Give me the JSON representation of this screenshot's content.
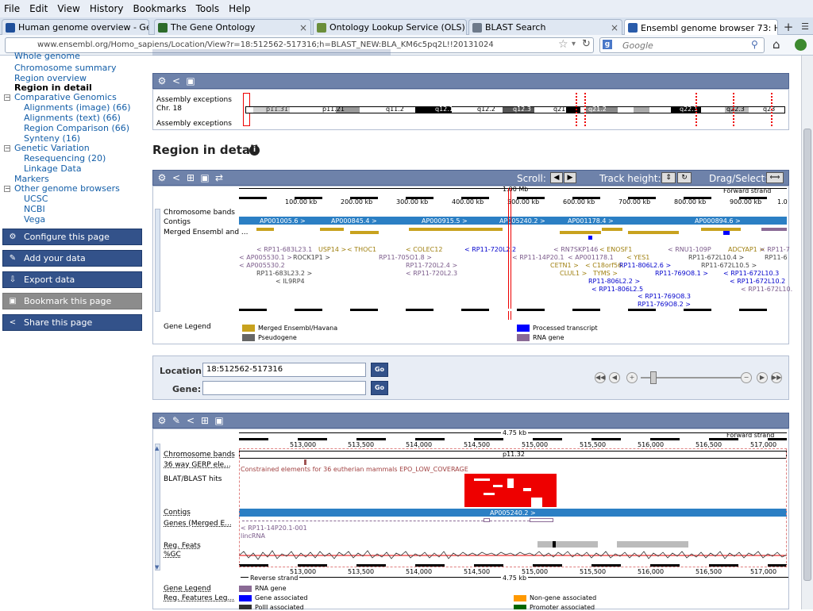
{
  "menu": [
    "File",
    "Edit",
    "View",
    "History",
    "Bookmarks",
    "Tools",
    "Help"
  ],
  "tabs": [
    {
      "label": "Human genome overview - Genome...",
      "color": "#1f4f9a"
    },
    {
      "label": "The Gene Ontology",
      "color": "#2d6b2a"
    },
    {
      "label": "Ontology Lookup Service (OLS)",
      "color": "#6b8e3a"
    },
    {
      "label": "BLAST Search",
      "color": "#6e7a8a"
    },
    {
      "label": "Ensembl genome browser 73: Homo...",
      "color": "#2a5caa"
    }
  ],
  "url": "www.ensembl.org/Homo_sapiens/Location/View?r=18:512562-517316;h=BLAST_NEW:BLA_KM6c5pq2L!!20131024",
  "search_placeholder": "Google",
  "sidebar": {
    "items": [
      {
        "label": "Whole genome",
        "level": 1,
        "selected": false
      },
      {
        "label": "Chromosome summary",
        "level": 1,
        "selected": false
      },
      {
        "label": "Region overview",
        "level": 1,
        "selected": false
      },
      {
        "label": "Region in detail",
        "level": 1,
        "selected": true
      },
      {
        "label": "Comparative Genomics",
        "level": 0,
        "selected": false
      },
      {
        "label": "Alignments (image) (66)",
        "level": 1,
        "selected": false
      },
      {
        "label": "Alignments (text) (66)",
        "level": 1,
        "selected": false
      },
      {
        "label": "Region Comparison (66)",
        "level": 1,
        "selected": false
      },
      {
        "label": "Synteny (16)",
        "level": 1,
        "selected": false
      },
      {
        "label": "Genetic Variation",
        "level": 0,
        "selected": false
      },
      {
        "label": "Resequencing (20)",
        "level": 1,
        "selected": false
      },
      {
        "label": "Linkage Data",
        "level": 1,
        "selected": false
      },
      {
        "label": "Markers",
        "level": 0,
        "selected": false
      },
      {
        "label": "Other genome browsers",
        "level": 0,
        "selected": false
      },
      {
        "label": "UCSC",
        "level": 1,
        "selected": false
      },
      {
        "label": "NCBI",
        "level": 1,
        "selected": false
      },
      {
        "label": "Vega",
        "level": 1,
        "selected": false
      }
    ],
    "buttons": [
      {
        "label": "Configure this page",
        "enabled": true
      },
      {
        "label": "Add your data",
        "enabled": true
      },
      {
        "label": "Export data",
        "enabled": true
      },
      {
        "label": "Bookmark this page",
        "enabled": false
      },
      {
        "label": "Share this page",
        "enabled": true
      }
    ]
  },
  "ideogram": {
    "label_exceptions_top": "Assembly exceptions",
    "label_chr": "Chr. 18",
    "label_exceptions_bottom": "Assembly exceptions",
    "bands": [
      "p11.31",
      "p11.21",
      "q11.2",
      "q12.1",
      "q12.2",
      "q12.3",
      "q21.1",
      "q21.2",
      "q22.1",
      "q22.3",
      "q23"
    ]
  },
  "region_title": "Region in detail",
  "region_panel": {
    "scroll_label": "Scroll:",
    "track_height_label": "Track height:",
    "drag_label": "Drag/Select:",
    "scale": "1.00 Mb",
    "strand": "Forward strand",
    "ticks": [
      "100.00 kb",
      "200.00 kb",
      "300.00 kb",
      "400.00 kb",
      "500.00 kb",
      "600.00 kb",
      "700.00 kb",
      "800.00 kb",
      "900.00 kb",
      "1.0"
    ],
    "track_labels": [
      "Chromosome bands",
      "Contigs",
      "Merged Ensembl and ..."
    ],
    "contigs": [
      "AP001005.6 >",
      "AP000845.4 >",
      "AP000915.5 >",
      "AP005240.2 >",
      "AP001178.4 >",
      "AP000894.6 >"
    ],
    "genes": [
      "< RP11-683L23.1",
      "USP14 >",
      "< THOC1",
      "< COLEC12",
      "< RP11-720L2.2",
      "< RP11-14P20.1",
      "< RN7SKP146",
      "< ENOSF1",
      "< RNU1-109P",
      "ADCYAP1 >",
      "< AP005530.1 >",
      "ROCK1P1 >",
      "RP11-705O1.8 >",
      "< AP001178.1",
      "< YES1",
      "RP11-672L10.4 >",
      "< AP005530.2",
      "RP11-720L2.4 >",
      "CETN1 >",
      "< C18orf56",
      "RP11-672L10.5 >",
      "RP11-683L23.2 >",
      "< RP11-720L2.3",
      "CLUL1 >",
      "TYMS >",
      "RP11-806L2.6 >",
      "< RP11-672L10.3",
      "< IL9RP4",
      "RP11-806L2.2 >",
      "RP11-769O8.1 >",
      "< RP11-672L10.2",
      "< RP11-806L2.5",
      "< RP11-672L10.",
      "< RP11-769O8.3",
      "RP11-769O8.2 >",
      "< RP11-7",
      "RP11-6"
    ],
    "legend_label": "Gene Legend",
    "legend": [
      {
        "label": "Merged Ensembl/Havana",
        "color": "#c8a21e"
      },
      {
        "label": "Processed transcript",
        "color": "#0000ff"
      },
      {
        "label": "Pseudogene",
        "color": "#666666"
      },
      {
        "label": "RNA gene",
        "color": "#8a6a95"
      }
    ]
  },
  "location_form": {
    "location_label": "Location:",
    "location_value": "18:512562-517316",
    "gene_label": "Gene:",
    "gene_value": "",
    "go": "Go"
  },
  "detail_panel": {
    "scale": "4.75 kb",
    "strand_fwd": "Forward strand",
    "strand_rev": "Reverse strand",
    "ticks": [
      "513,000",
      "513,500",
      "514,000",
      "514,500",
      "515,000",
      "515,500",
      "516,000",
      "516,500",
      "517,000"
    ],
    "band": "p11.32",
    "contig": "AP005240.2 >",
    "track_labels": [
      "Chromosome bands",
      "36 way GERP ele...",
      "BLAT/BLAST hits",
      "Contigs",
      "Genes (Merged E...",
      "Reg. Feats",
      "%GC"
    ],
    "gerp_text": "Constrained elements for 36 eutherian mammals EPO_LOW_COVERAGE",
    "gene_name": "< RP11-14P20.1-001",
    "gene_type": "lincRNA",
    "legend_label": "Gene Legend",
    "legend_gene": "RNA gene",
    "reg_legend_label": "Reg. Features Leg...",
    "reg_legend": [
      {
        "label": "Gene associated",
        "color": "#0000ff"
      },
      {
        "label": "Non-gene associated",
        "color": "#ff9900"
      },
      {
        "label": "PolII associated",
        "color": "#333333"
      },
      {
        "label": "Promoter associated",
        "color": "#006600"
      }
    ],
    "gene_legend_color": "#8a6a95"
  }
}
